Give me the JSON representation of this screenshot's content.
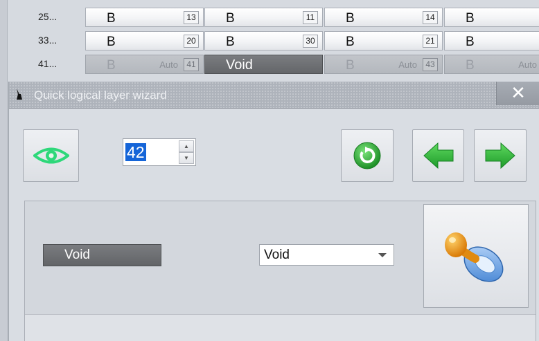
{
  "grid": {
    "rows": [
      {
        "label": "25...",
        "cells": [
          {
            "letter": "B",
            "num": "13"
          },
          {
            "letter": "B",
            "num": "11"
          },
          {
            "letter": "B",
            "num": "14"
          },
          {
            "letter": "B",
            "num": ""
          }
        ]
      },
      {
        "label": "33...",
        "cells": [
          {
            "letter": "B",
            "num": "20"
          },
          {
            "letter": "B",
            "num": "30"
          },
          {
            "letter": "B",
            "num": "21"
          },
          {
            "letter": "B",
            "num": ""
          }
        ]
      },
      {
        "label": "41...",
        "cells": [
          {
            "letter": "B",
            "auto": "Auto",
            "num": "41"
          },
          {
            "void": "Void"
          },
          {
            "letter": "B",
            "auto": "Auto",
            "num": "43"
          },
          {
            "letter": "B",
            "auto": "Auto",
            "num": ""
          }
        ]
      }
    ]
  },
  "dialog": {
    "title": "Quick logical layer wizard",
    "close_label": "✕",
    "spin_value": "42",
    "void_chip": "Void",
    "select_value": "Void"
  },
  "icons": {
    "eye": "eye-icon",
    "refresh": "refresh-icon",
    "prev": "arrow-left-icon",
    "next": "arrow-right-icon",
    "apply": "pacifier-icon",
    "colors": {
      "green": "#2fb83a",
      "eye": "#2ed87a",
      "orange": "#f39a1a",
      "blue": "#6aa6e8"
    }
  }
}
